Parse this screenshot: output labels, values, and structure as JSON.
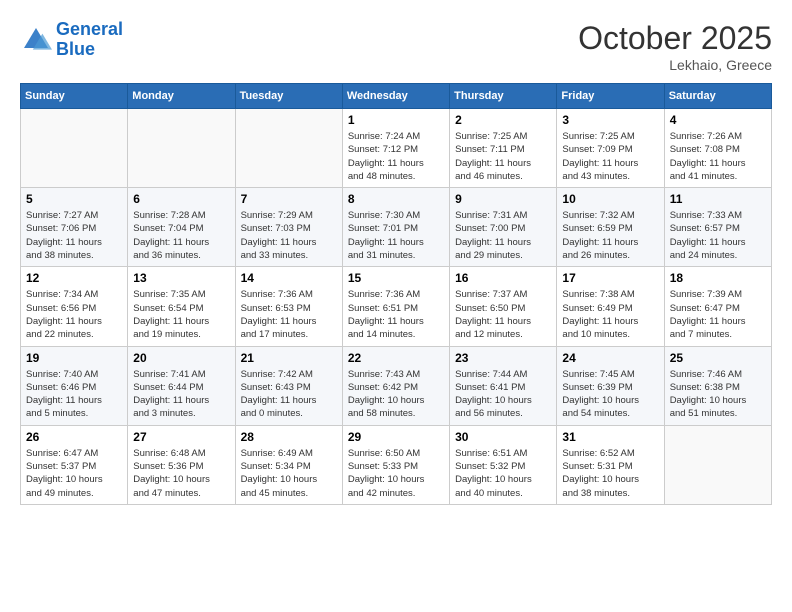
{
  "header": {
    "logo_line1": "General",
    "logo_line2": "Blue",
    "month": "October 2025",
    "location": "Lekhaio, Greece"
  },
  "weekdays": [
    "Sunday",
    "Monday",
    "Tuesday",
    "Wednesday",
    "Thursday",
    "Friday",
    "Saturday"
  ],
  "weeks": [
    [
      {
        "day": "",
        "text": ""
      },
      {
        "day": "",
        "text": ""
      },
      {
        "day": "",
        "text": ""
      },
      {
        "day": "1",
        "text": "Sunrise: 7:24 AM\nSunset: 7:12 PM\nDaylight: 11 hours\nand 48 minutes."
      },
      {
        "day": "2",
        "text": "Sunrise: 7:25 AM\nSunset: 7:11 PM\nDaylight: 11 hours\nand 46 minutes."
      },
      {
        "day": "3",
        "text": "Sunrise: 7:25 AM\nSunset: 7:09 PM\nDaylight: 11 hours\nand 43 minutes."
      },
      {
        "day": "4",
        "text": "Sunrise: 7:26 AM\nSunset: 7:08 PM\nDaylight: 11 hours\nand 41 minutes."
      }
    ],
    [
      {
        "day": "5",
        "text": "Sunrise: 7:27 AM\nSunset: 7:06 PM\nDaylight: 11 hours\nand 38 minutes."
      },
      {
        "day": "6",
        "text": "Sunrise: 7:28 AM\nSunset: 7:04 PM\nDaylight: 11 hours\nand 36 minutes."
      },
      {
        "day": "7",
        "text": "Sunrise: 7:29 AM\nSunset: 7:03 PM\nDaylight: 11 hours\nand 33 minutes."
      },
      {
        "day": "8",
        "text": "Sunrise: 7:30 AM\nSunset: 7:01 PM\nDaylight: 11 hours\nand 31 minutes."
      },
      {
        "day": "9",
        "text": "Sunrise: 7:31 AM\nSunset: 7:00 PM\nDaylight: 11 hours\nand 29 minutes."
      },
      {
        "day": "10",
        "text": "Sunrise: 7:32 AM\nSunset: 6:59 PM\nDaylight: 11 hours\nand 26 minutes."
      },
      {
        "day": "11",
        "text": "Sunrise: 7:33 AM\nSunset: 6:57 PM\nDaylight: 11 hours\nand 24 minutes."
      }
    ],
    [
      {
        "day": "12",
        "text": "Sunrise: 7:34 AM\nSunset: 6:56 PM\nDaylight: 11 hours\nand 22 minutes."
      },
      {
        "day": "13",
        "text": "Sunrise: 7:35 AM\nSunset: 6:54 PM\nDaylight: 11 hours\nand 19 minutes."
      },
      {
        "day": "14",
        "text": "Sunrise: 7:36 AM\nSunset: 6:53 PM\nDaylight: 11 hours\nand 17 minutes."
      },
      {
        "day": "15",
        "text": "Sunrise: 7:36 AM\nSunset: 6:51 PM\nDaylight: 11 hours\nand 14 minutes."
      },
      {
        "day": "16",
        "text": "Sunrise: 7:37 AM\nSunset: 6:50 PM\nDaylight: 11 hours\nand 12 minutes."
      },
      {
        "day": "17",
        "text": "Sunrise: 7:38 AM\nSunset: 6:49 PM\nDaylight: 11 hours\nand 10 minutes."
      },
      {
        "day": "18",
        "text": "Sunrise: 7:39 AM\nSunset: 6:47 PM\nDaylight: 11 hours\nand 7 minutes."
      }
    ],
    [
      {
        "day": "19",
        "text": "Sunrise: 7:40 AM\nSunset: 6:46 PM\nDaylight: 11 hours\nand 5 minutes."
      },
      {
        "day": "20",
        "text": "Sunrise: 7:41 AM\nSunset: 6:44 PM\nDaylight: 11 hours\nand 3 minutes."
      },
      {
        "day": "21",
        "text": "Sunrise: 7:42 AM\nSunset: 6:43 PM\nDaylight: 11 hours\nand 0 minutes."
      },
      {
        "day": "22",
        "text": "Sunrise: 7:43 AM\nSunset: 6:42 PM\nDaylight: 10 hours\nand 58 minutes."
      },
      {
        "day": "23",
        "text": "Sunrise: 7:44 AM\nSunset: 6:41 PM\nDaylight: 10 hours\nand 56 minutes."
      },
      {
        "day": "24",
        "text": "Sunrise: 7:45 AM\nSunset: 6:39 PM\nDaylight: 10 hours\nand 54 minutes."
      },
      {
        "day": "25",
        "text": "Sunrise: 7:46 AM\nSunset: 6:38 PM\nDaylight: 10 hours\nand 51 minutes."
      }
    ],
    [
      {
        "day": "26",
        "text": "Sunrise: 6:47 AM\nSunset: 5:37 PM\nDaylight: 10 hours\nand 49 minutes."
      },
      {
        "day": "27",
        "text": "Sunrise: 6:48 AM\nSunset: 5:36 PM\nDaylight: 10 hours\nand 47 minutes."
      },
      {
        "day": "28",
        "text": "Sunrise: 6:49 AM\nSunset: 5:34 PM\nDaylight: 10 hours\nand 45 minutes."
      },
      {
        "day": "29",
        "text": "Sunrise: 6:50 AM\nSunset: 5:33 PM\nDaylight: 10 hours\nand 42 minutes."
      },
      {
        "day": "30",
        "text": "Sunrise: 6:51 AM\nSunset: 5:32 PM\nDaylight: 10 hours\nand 40 minutes."
      },
      {
        "day": "31",
        "text": "Sunrise: 6:52 AM\nSunset: 5:31 PM\nDaylight: 10 hours\nand 38 minutes."
      },
      {
        "day": "",
        "text": ""
      }
    ]
  ]
}
